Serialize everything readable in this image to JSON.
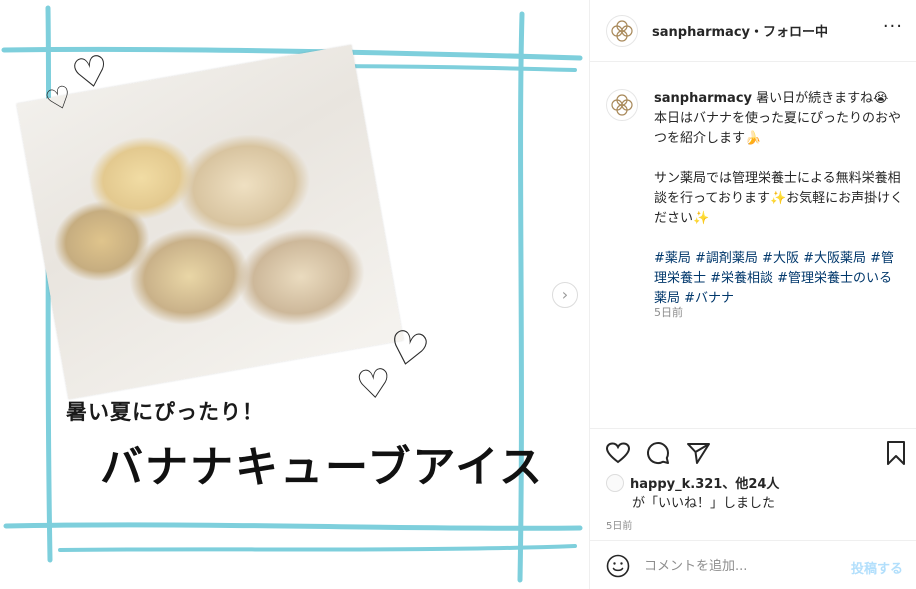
{
  "colors": {
    "frame_line": "#7ecfdc",
    "link": "#00376b",
    "secondary_text": "#8e8e8e",
    "post_button_disabled": "#b2dffc"
  },
  "media": {
    "caption_small": "暑い夏にぴったり！",
    "caption_big": "バナナキューブアイス",
    "next_icon": "chevron-right-icon",
    "next_glyph": "›",
    "heart_glyph": "♡"
  },
  "header": {
    "username": "sanpharmacy",
    "separator": "・",
    "follow_status": "フォロー中",
    "more_glyph": "···"
  },
  "caption": {
    "username": "sanpharmacy",
    "line1": "暑い日が続きますね😭",
    "line2": "本日はバナナを使った夏にぴったりのおやつを紹介します🍌",
    "line3": "サン薬局では管理栄養士による無料栄養相談を行っております✨お気軽にお声掛けください✨",
    "hashtags": "#薬局 #調剤薬局 #大阪 #大阪薬局 #管理栄養士 #栄養相談 #管理栄養士のいる薬局 #バナナ",
    "time": "5日前"
  },
  "actions": {
    "like_icon": "heart-outline-icon",
    "comment_icon": "comment-bubble-icon",
    "share_icon": "paper-plane-icon",
    "save_icon": "bookmark-icon"
  },
  "likes": {
    "first_user": "happy_k.321",
    "others": "、他24人",
    "suffix": "が「いいね！」しました",
    "time": "5日前"
  },
  "comment": {
    "placeholder": "コメントを追加...",
    "post_label": "投稿する"
  }
}
